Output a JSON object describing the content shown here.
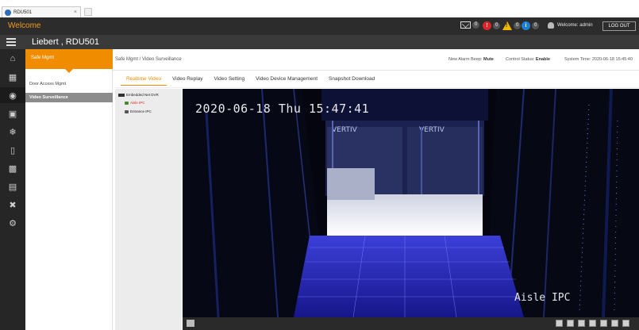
{
  "browser": {
    "tab_title": "RDU501",
    "close_glyph": "×"
  },
  "header": {
    "app_title": "Welcome",
    "alarms": [
      {
        "icon": "mail-icon",
        "count": "0"
      },
      {
        "icon": "critical-alarm-icon",
        "count": "0",
        "color": "#d9262c"
      },
      {
        "icon": "warning-alarm-icon",
        "count": "0",
        "color": "#f5b800"
      },
      {
        "icon": "info-alarm-icon",
        "count": "0",
        "color": "#1e7fd6"
      }
    ],
    "welcome_text": "Welcome: admin",
    "logout_label": "LOG OUT"
  },
  "device": {
    "name": "Liebert , RDU501"
  },
  "sidebar": {
    "icons": [
      "home-icon",
      "device-icon",
      "shield-icon",
      "equipment-icon",
      "snowflake-icon",
      "battery-icon",
      "chart-icon",
      "report-icon",
      "tools-icon",
      "gear-icon"
    ],
    "active_index": 2
  },
  "submenu": {
    "title": "Safe Mgmt",
    "items": [
      "Door Access Mgmt",
      "Video Surveillance"
    ],
    "selected": 1
  },
  "content": {
    "breadcrumb": "Safe Mgmt /  Video Surveillance",
    "status": {
      "beep_label": "New Alarm Beep:",
      "beep_value": "Mute",
      "control_label": "Control Status:",
      "control_value": "Enable",
      "time_label": "System Time:",
      "time_value": "2020-06-18 15:45:40"
    },
    "tabs": [
      "Realtime Video",
      "Video Replay",
      "Video Setting",
      "Video Device Management",
      "Snapshot Download"
    ],
    "active_tab": 0
  },
  "tree": {
    "root": "Embedded Net DVR",
    "cameras": [
      {
        "label": "Aisle IPC",
        "active": true
      },
      {
        "label": "Entrance IPC",
        "active": false
      }
    ]
  },
  "video": {
    "timestamp": "2020-06-18 Thu 15:47:41",
    "camera_name": "Aisle IPC",
    "toolbar_left_icon": "layout-icon",
    "toolbar_buttons": [
      "screen-icon",
      "snapshot-icon",
      "record-icon",
      "zoom-icon",
      "prev-icon",
      "next-icon",
      "volume-icon"
    ]
  },
  "colors": {
    "accent": "#f08c00",
    "header_bg": "#2c2c2c",
    "rail_bg": "#262626"
  }
}
